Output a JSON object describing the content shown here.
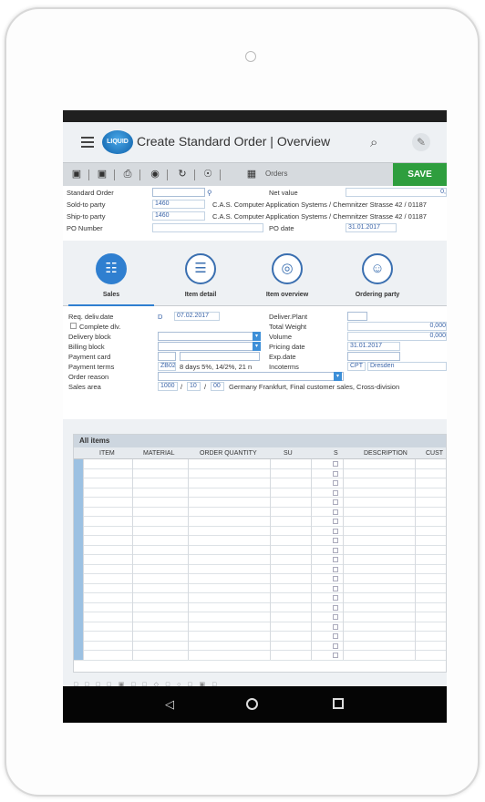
{
  "app": {
    "title": "Create Standard Order | Overview",
    "logo_text": "LIQUID"
  },
  "toolbar": {
    "orders_label": "Orders",
    "save_label": "SAVE"
  },
  "header": {
    "standard_order_label": "Standard Order",
    "standard_order_value": "",
    "net_value_label": "Net value",
    "net_value": "0,",
    "sold_to_label": "Sold-to party",
    "sold_to_value": "1460",
    "sold_to_desc": "C.A.S. Computer Application Systems / Chemnitzer Strasse 42 / 01187",
    "ship_to_label": "Ship-to party",
    "ship_to_value": "1460",
    "ship_to_desc": "C.A.S. Computer Application Systems / Chemnitzer Strasse 42 / 01187",
    "po_number_label": "PO Number",
    "po_number_value": "",
    "po_date_label": "PO date",
    "po_date_value": "31.01.2017"
  },
  "tabs": [
    {
      "label": "Sales"
    },
    {
      "label": "Item detail"
    },
    {
      "label": "Item overview"
    },
    {
      "label": "Ordering party"
    }
  ],
  "sales": {
    "req_deliv_label": "Req. deliv.date",
    "req_deliv_prefix": "D",
    "req_deliv_value": "07.02.2017",
    "deliver_plant_label": "Deliver.Plant",
    "complete_dlv_label": "Complete dlv.",
    "total_weight_label": "Total Weight",
    "total_weight_value": "0,000",
    "delivery_block_label": "Delivery block",
    "volume_label": "Volume",
    "volume_value": "0,000",
    "billing_block_label": "Billing block",
    "pricing_date_label": "Pricing date",
    "pricing_date_value": "31.01.2017",
    "payment_card_label": "Payment card",
    "exp_date_label": "Exp.date",
    "payment_terms_label": "Payment terms",
    "payment_terms_code": "ZB02",
    "payment_terms_desc": "8 days 5%, 14/2%, 21 n",
    "incoterms_label": "Incoterms",
    "incoterms_code": "CPT",
    "incoterms_place": "Dresden",
    "order_reason_label": "Order reason",
    "sales_area_label": "Sales area",
    "sales_org": "1000",
    "dist_channel": "10",
    "division": "00",
    "sales_area_desc": "Germany Frankfurt, Final customer sales, Cross-division"
  },
  "items": {
    "title": "All items",
    "columns": [
      "ITEM",
      "MATERIAL",
      "ORDER QUANTITY",
      "SU",
      "S",
      "DESCRIPTION",
      "CUST"
    ]
  }
}
